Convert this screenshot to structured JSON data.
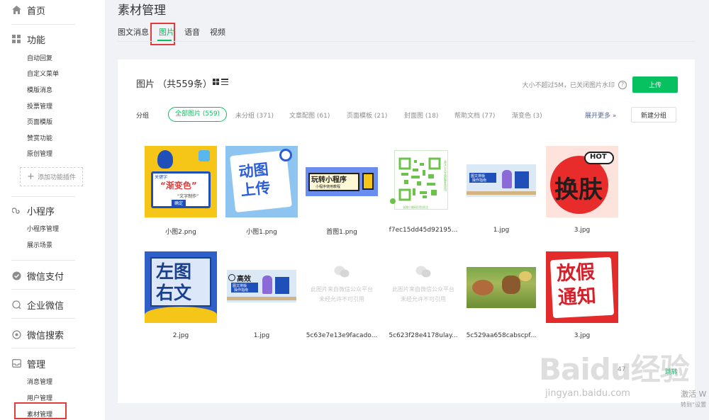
{
  "sidebar": {
    "home": "首页",
    "function_title": "功能",
    "function_items": [
      "自动回复",
      "自定义菜单",
      "模版消息",
      "投票管理",
      "页面模版",
      "赞赏功能",
      "原创管理"
    ],
    "add_plugin": "添加功能插件",
    "miniprogram_title": "小程序",
    "miniprogram_items": [
      "小程序管理",
      "展示场景"
    ],
    "wechat_pay": "微信支付",
    "work_wechat": "企业微信",
    "wechat_search": "微信搜索",
    "manage_title": "管理",
    "manage_items": [
      "消息管理",
      "用户管理",
      "素材管理"
    ]
  },
  "page_title": "素材管理",
  "tabs": [
    "图文消息",
    "图片",
    "语音",
    "视频"
  ],
  "card": {
    "title": "图片 （共559条）",
    "hint": "大小不超过5M，已关闭图片水印",
    "upload": "上传",
    "group_label": "分组",
    "groups": [
      "全部图片 (559)",
      "未分组 (371)",
      "文章配图 (61)",
      "页面模板 (21)",
      "封面图 (18)",
      "帮助文档 (77)",
      "渐变色 (3)"
    ],
    "expand_more": "展开更多",
    "new_group": "新建分组"
  },
  "images": [
    {
      "caption": "小图2.png",
      "art": "小图2"
    },
    {
      "caption": "小图1.png",
      "art": "小图1"
    },
    {
      "caption": "首图1.png",
      "art": "首图1"
    },
    {
      "caption": "f7ec15dd45d92195...",
      "art": "qr"
    },
    {
      "caption": "1.jpg",
      "art": "1a"
    },
    {
      "caption": "3.jpg",
      "art": "3a"
    },
    {
      "caption": "2.jpg",
      "art": "2"
    },
    {
      "caption": "1.jpg",
      "art": "1b"
    },
    {
      "caption": "5c63e7e13e9facado...",
      "art": "blocked1"
    },
    {
      "caption": "5c623f28e4178ulay...",
      "art": "blocked2"
    },
    {
      "caption": "5c529aa658cabscpf...",
      "art": "photo"
    },
    {
      "caption": "3.jpg",
      "art": "3b"
    }
  ],
  "art_text": {
    "poster_key": "关键字",
    "poster_main": "“渐变色”",
    "poster_sub": "“文字制作”",
    "poster_btn": "确定",
    "dongtu1": "动图",
    "dongtu2": "上传",
    "banner_title": "玩转小程序",
    "banner_sub": "小程序使用教程",
    "gaoxiao": "高效",
    "gaoxiao_sub": "图文排版",
    "gaoxiao_sub2": "操作指南",
    "hot": "HOT",
    "huanfu": "换肤",
    "zuotu1": "左图",
    "zuotu2": "右文",
    "blocked1": "此图片来自微信公众平台",
    "blocked2": "未经允许不可引用",
    "fangjia1": "放假",
    "fangjia2": "通知",
    "qr_side": "关注公众号获取更多资讯",
    "qr_bottom": "长按二维码识别关注"
  },
  "footer": {
    "page_frag": "47",
    "jump": "跳转",
    "watermark": "Baidu经验",
    "watermark_url": "jingyan.baidu.com",
    "activate": "激活 W",
    "activate_sub": "转到“设置"
  },
  "colors": {
    "accent": "#07c160",
    "highlight": "#e33b3b",
    "link": "#576b95"
  }
}
